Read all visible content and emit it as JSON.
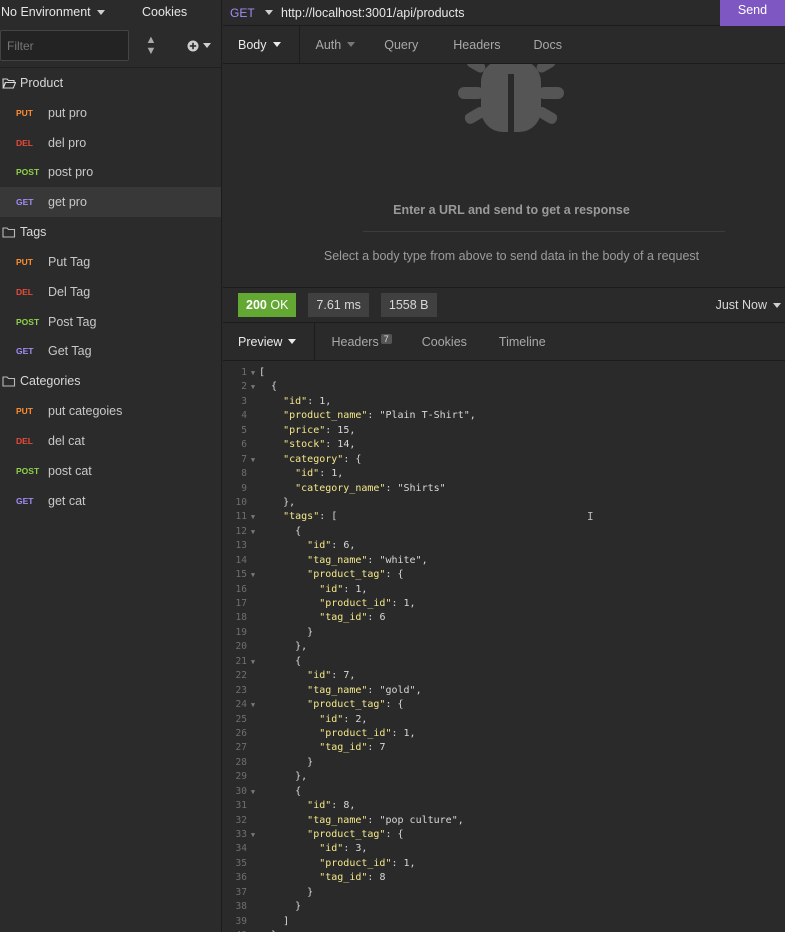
{
  "sidebar": {
    "environment": "No Environment",
    "cookies": "Cookies",
    "filter_placeholder": "Filter",
    "folders": [
      {
        "name": "Product",
        "open": true,
        "requests": [
          {
            "method": "PUT",
            "label": "put pro"
          },
          {
            "method": "DEL",
            "label": "del pro"
          },
          {
            "method": "POST",
            "label": "post pro"
          },
          {
            "method": "GET",
            "label": "get pro",
            "active": true
          }
        ]
      },
      {
        "name": "Tags",
        "open": true,
        "requests": [
          {
            "method": "PUT",
            "label": "Put Tag"
          },
          {
            "method": "DEL",
            "label": "Del Tag"
          },
          {
            "method": "POST",
            "label": "Post Tag"
          },
          {
            "method": "GET",
            "label": "Get Tag"
          }
        ]
      },
      {
        "name": "Categories",
        "open": true,
        "requests": [
          {
            "method": "PUT",
            "label": "put categoies"
          },
          {
            "method": "DEL",
            "label": "del cat"
          },
          {
            "method": "POST",
            "label": "post cat"
          },
          {
            "method": "GET",
            "label": "get cat"
          }
        ]
      }
    ]
  },
  "request": {
    "method": "GET",
    "url": "http://localhost:3001/api/products",
    "send_label": "Send",
    "tabs": [
      "Body",
      "Auth",
      "Query",
      "Headers",
      "Docs"
    ],
    "empty_title": "Enter a URL and send to get a response",
    "empty_hint": "Select a body type from above to send data in the body of a request"
  },
  "response": {
    "status_code": "200",
    "status_text": "OK",
    "time": "7.61 ms",
    "size": "1558 B",
    "timestamp": "Just Now",
    "tabs": [
      "Preview",
      "Headers",
      "Cookies",
      "Timeline"
    ],
    "headers_count": "7",
    "body_lines": [
      "[",
      "  {",
      "    \"id\": 1,",
      "    \"product_name\": \"Plain T-Shirt\",",
      "    \"price\": 15,",
      "    \"stock\": 14,",
      "    \"category\": {",
      "      \"id\": 1,",
      "      \"category_name\": \"Shirts\"",
      "    },",
      "    \"tags\": [",
      "      {",
      "        \"id\": 6,",
      "        \"tag_name\": \"white\",",
      "        \"product_tag\": {",
      "          \"id\": 1,",
      "          \"product_id\": 1,",
      "          \"tag_id\": 6",
      "        }",
      "      },",
      "      {",
      "        \"id\": 7,",
      "        \"tag_name\": \"gold\",",
      "        \"product_tag\": {",
      "          \"id\": 2,",
      "          \"product_id\": 1,",
      "          \"tag_id\": 7",
      "        }",
      "      },",
      "      {",
      "        \"id\": 8,",
      "        \"tag_name\": \"pop culture\",",
      "        \"product_tag\": {",
      "          \"id\": 3,",
      "          \"product_id\": 1,",
      "          \"tag_id\": 8",
      "        }",
      "      }",
      "    ]",
      "  },"
    ]
  },
  "colors": {
    "accent": "#7e57c2",
    "status_ok": "#63a833",
    "put": "#ff8c2e",
    "del": "#e84a3a",
    "post": "#8fd14a",
    "get": "#a48cf7"
  }
}
